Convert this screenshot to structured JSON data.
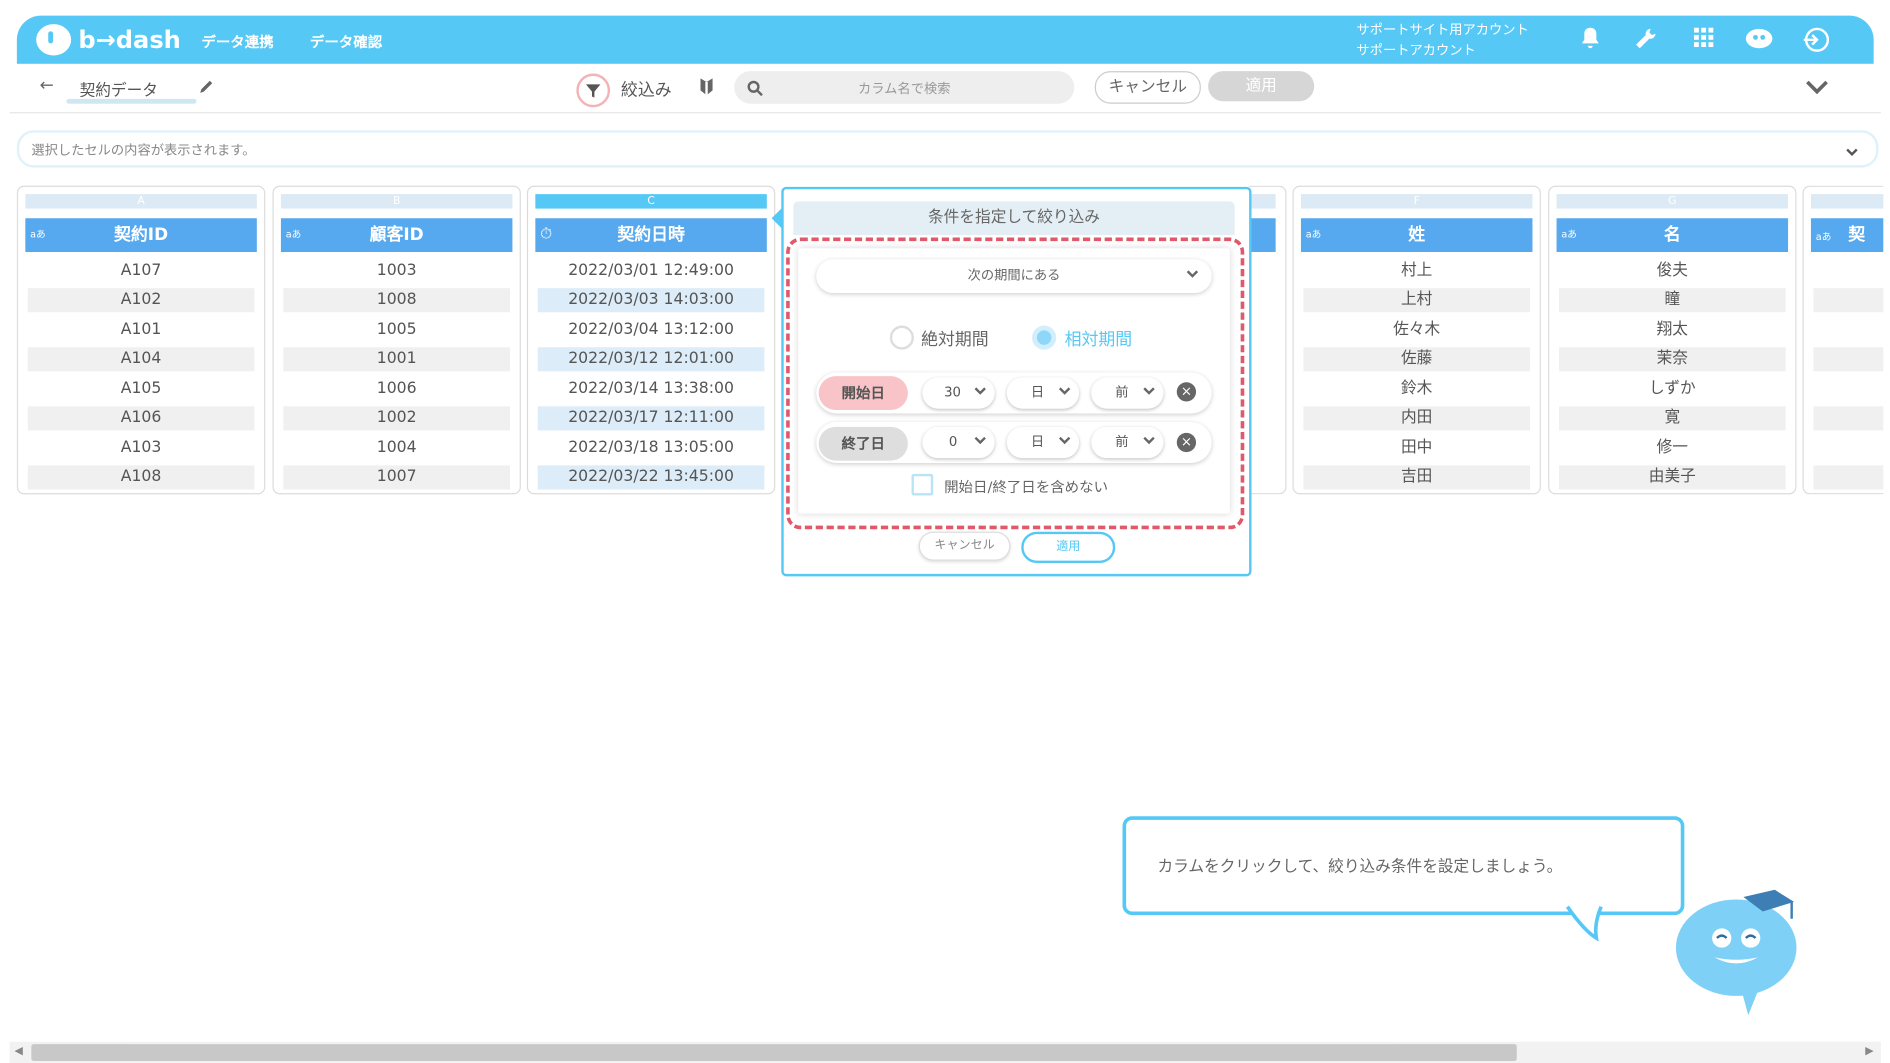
{
  "header": {
    "logo": "b→dash",
    "nav": [
      "データ連携",
      "データ確認"
    ],
    "account_line1": "サポートサイト用アカウント",
    "account_line2": "サポートアカウント"
  },
  "toolbar": {
    "back": "←",
    "table_name": "契約データ",
    "filter_label": "絞込み",
    "search_placeholder": "カラム名で検索",
    "cancel": "キャンセル",
    "apply": "適用"
  },
  "selection_bar": {
    "placeholder": "選択したセルの内容が表示されます。"
  },
  "columns": [
    {
      "letter": "A",
      "type": "aあ",
      "name": "契約ID",
      "cells": [
        "A107",
        "A102",
        "A101",
        "A104",
        "A105",
        "A106",
        "A103",
        "A108"
      ]
    },
    {
      "letter": "B",
      "type": "aあ",
      "name": "顧客ID",
      "cells": [
        "1003",
        "1008",
        "1005",
        "1001",
        "1006",
        "1002",
        "1004",
        "1007"
      ]
    },
    {
      "letter": "C",
      "type": "⏱",
      "name": "契約日時",
      "cells": [
        "2022/03/01 12:49:00",
        "2022/03/03 14:03:00",
        "2022/03/04 13:12:00",
        "2022/03/12 12:01:00",
        "2022/03/14 13:38:00",
        "2022/03/17 12:11:00",
        "2022/03/18 13:05:00",
        "2022/03/22 13:45:00"
      ]
    },
    {
      "letter": "F",
      "type": "aあ",
      "name": "姓",
      "cells": [
        "村上",
        "上村",
        "佐々木",
        "佐藤",
        "鈴木",
        "内田",
        "田中",
        "吉田"
      ]
    },
    {
      "letter": "G",
      "type": "aあ",
      "name": "名",
      "cells": [
        "俊夫",
        "瞳",
        "翔太",
        "茉奈",
        "しずか",
        "寛",
        "修一",
        "由美子"
      ]
    },
    {
      "letter": "",
      "type": "aあ",
      "name": "契",
      "cells": [
        "",
        "",
        "",
        "",
        "",
        "",
        "",
        ""
      ]
    }
  ],
  "popup": {
    "title": "条件を指定して絞り込み",
    "condition": "次の期間にある",
    "radio_absolute": "絶対期間",
    "radio_relative": "相対期間",
    "start_label": "開始日",
    "start_num": "30",
    "start_unit": "日",
    "start_dir": "前",
    "end_label": "終了日",
    "end_num": "0",
    "end_unit": "日",
    "end_dir": "前",
    "exclude_label": "開始日/終了日を含めない",
    "cancel": "キャンセル",
    "apply": "適用"
  },
  "tooltip": {
    "text": "カラムをクリックして、絞り込み条件を設定しましょう。"
  },
  "colors": {
    "primary": "#56c8f5",
    "header_col": "#56a9ee",
    "accent_red": "#e0596b"
  }
}
